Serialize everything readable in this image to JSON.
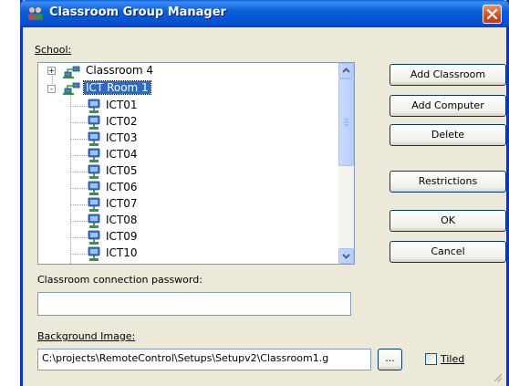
{
  "window": {
    "title": "Classroom Group Manager",
    "app_icon": "people-group-icon",
    "close_icon": "close-icon"
  },
  "school_label": "School:",
  "tree": {
    "nodes": [
      {
        "label": "Classroom 4",
        "icon": "network-group-icon",
        "expander": "+",
        "selected": false
      },
      {
        "label": "ICT Room 1",
        "icon": "network-group-icon",
        "expander": "-",
        "selected": true
      }
    ],
    "children": [
      "ICT01",
      "ICT02",
      "ICT03",
      "ICT04",
      "ICT05",
      "ICT06",
      "ICT07",
      "ICT08",
      "ICT09",
      "ICT10"
    ],
    "child_icon": "computer-icon"
  },
  "buttons": {
    "add_classroom": "Add Classroom",
    "add_computer": "Add Computer",
    "delete": "Delete",
    "restrictions": "Restrictions",
    "ok": "OK",
    "cancel": "Cancel",
    "browse": "..."
  },
  "password": {
    "label": "Classroom connection password:",
    "value": ""
  },
  "background_image": {
    "label": "Background Image:",
    "value": "C:\\projects\\RemoteControl\\Setups\\Setupv2\\Classroom1.g",
    "tiled_label": "Tiled",
    "tiled_checked": false
  },
  "colors": {
    "titlebar": "#0a5fd8",
    "dialog_bg": "#ece9d8",
    "selection": "#316ac5",
    "close_button": "#d44a22"
  }
}
